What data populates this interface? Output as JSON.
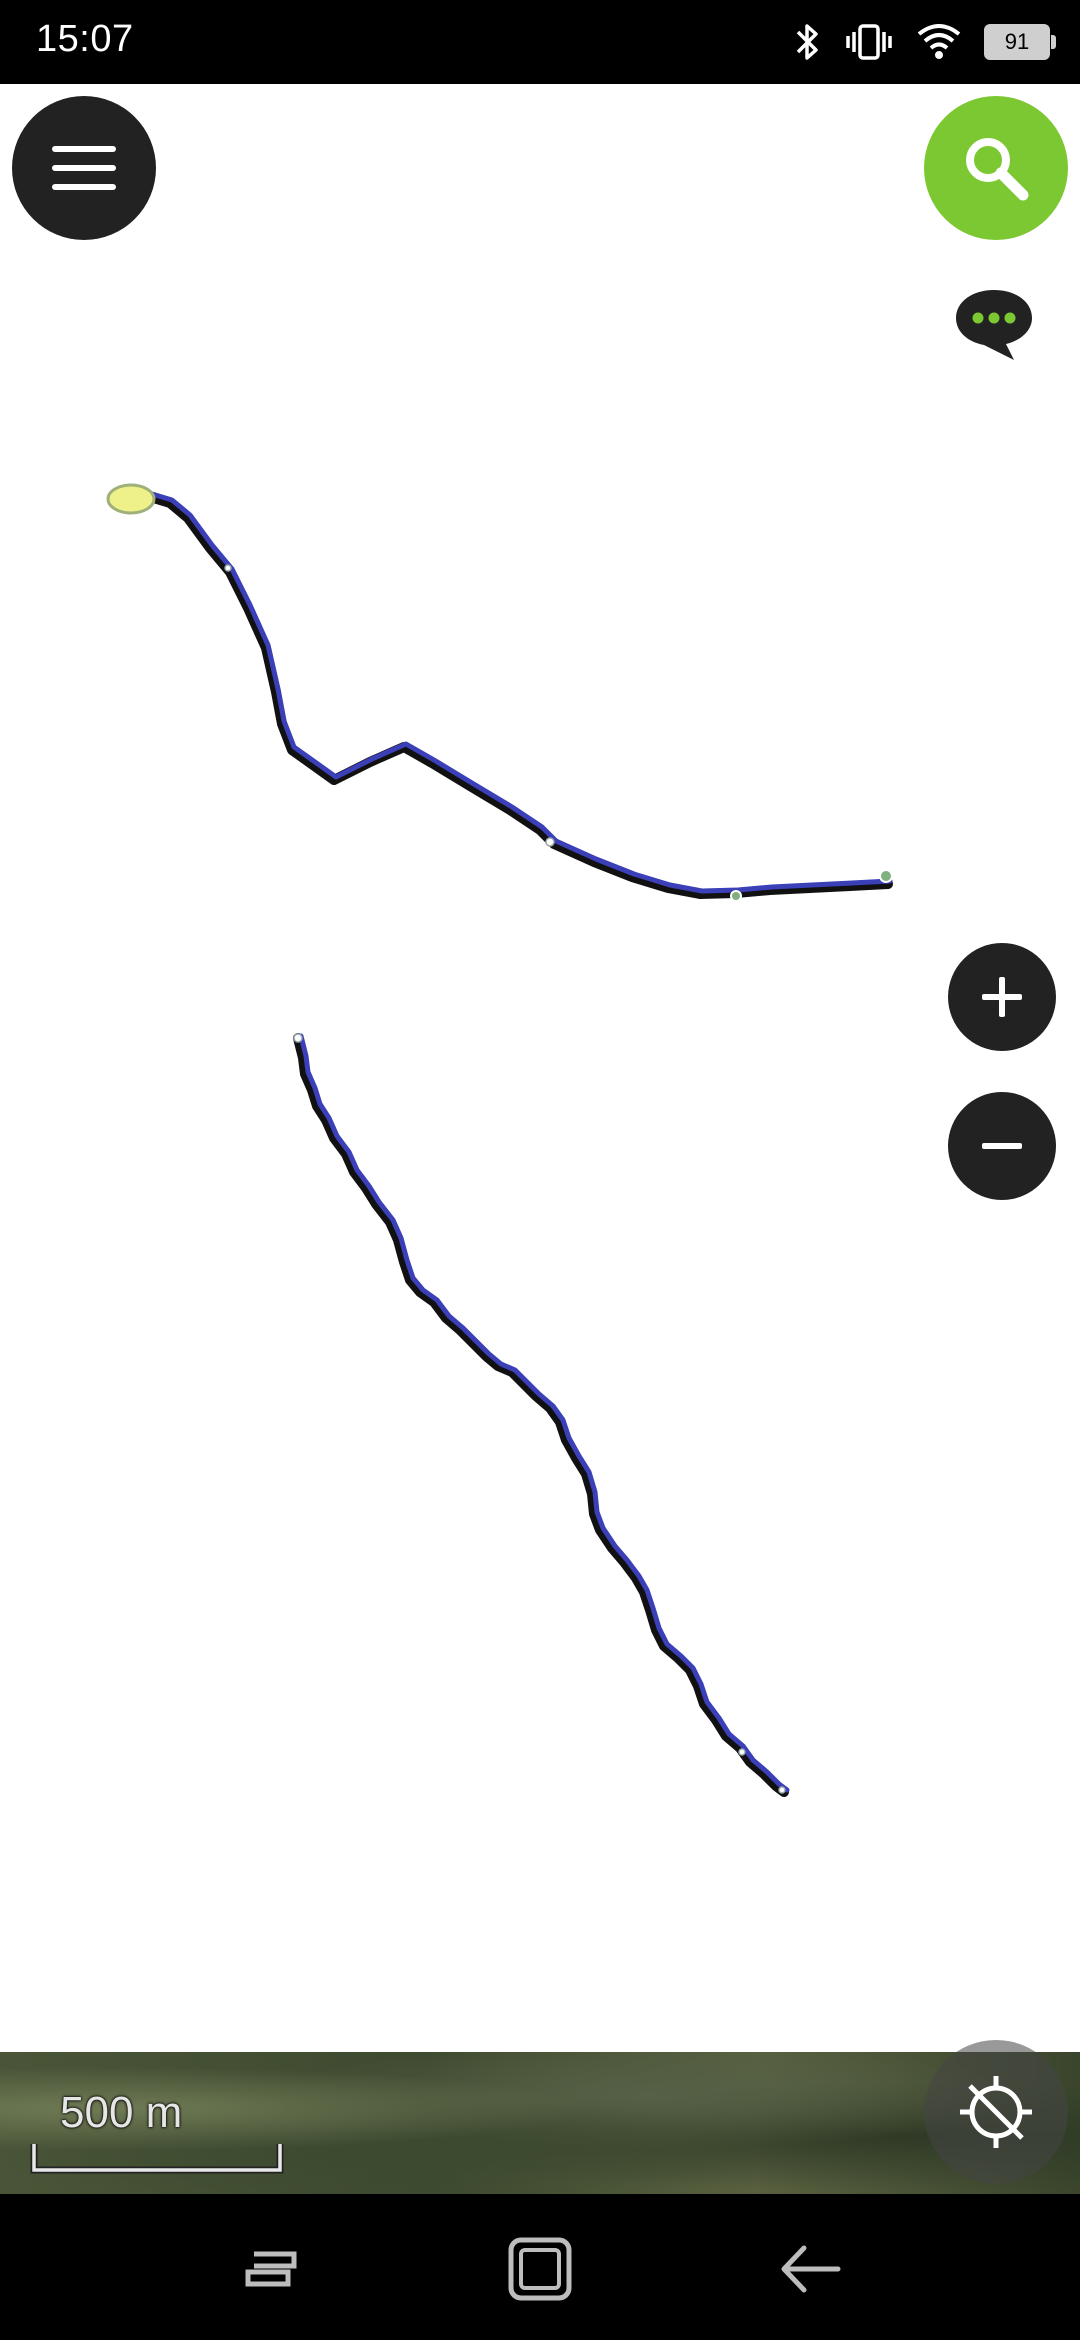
{
  "status_bar": {
    "time": "15:07",
    "battery_level": "91",
    "icons": [
      "bluetooth-icon",
      "vibrate-icon",
      "wifi-icon",
      "battery-icon"
    ]
  },
  "map": {
    "scale_label": "500 m",
    "track_color": "#3b3fb8",
    "track_outline_color": "#111111",
    "start_marker_color": "#eef08a"
  },
  "controls": {
    "menu_icon": "hamburger-menu-icon",
    "search_icon": "search-icon",
    "chat_icon": "chat-bubble-icon",
    "zoom_in_icon": "plus-icon",
    "zoom_out_icon": "minus-icon",
    "locate_icon": "gps-locate-icon",
    "search_color": "#7cc832",
    "dark_button_color": "#222222"
  },
  "nav_bar": {
    "icons": [
      "recents-icon",
      "home-icon",
      "back-icon"
    ]
  }
}
